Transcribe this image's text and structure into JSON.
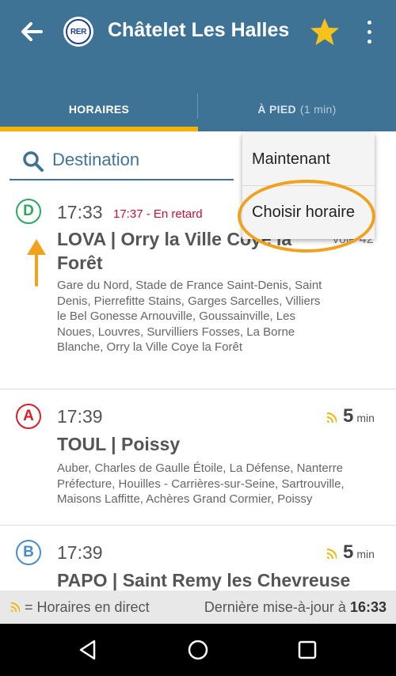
{
  "header": {
    "title": "Châtelet Les Halles",
    "network_badge": "RER",
    "back_icon": "arrow-left-icon",
    "favorite_icon": "star-icon",
    "more_icon": "more-vert-icon"
  },
  "tabs": [
    {
      "label": "HORAIRES",
      "active": true
    },
    {
      "label": "À PIED",
      "extra": "(1 min)",
      "active": false
    }
  ],
  "search": {
    "placeholder": "Destination"
  },
  "menu": {
    "items": [
      "Maintenant",
      "Choisir horaire"
    ]
  },
  "departures": [
    {
      "line": "D",
      "line_color": "#2ba760",
      "time": "17:33",
      "delay_text": "17:37 - En retard",
      "platform": "voie 42",
      "destination": "LOVA | Orry la Ville Coye la Forêt",
      "stops": "Gare du Nord, Stade de France Saint-Denis, Saint Denis, Pierrefitte Stains, Garges Sarcelles, Villiers le Bel Gonesse Arnouville, Goussainville, Les Noues, Louvres, Survilliers Fosses, La Borne Blanche, Orry la Ville Coye la Forêt"
    },
    {
      "line": "A",
      "line_color": "#d81e2b",
      "time": "17:39",
      "minutes": "5",
      "unit": "min",
      "destination": "TOUL | Poissy",
      "stops": "Auber, Charles de Gaulle Étoile, La Défense, Nanterre Préfecture, Houilles - Carrières-sur-Seine, Sartrouville, Maisons Laffitte, Achères Grand Cormier, Poissy"
    },
    {
      "line": "B",
      "line_color": "#4a8cc9",
      "time": "17:39",
      "minutes": "5",
      "unit": "min",
      "destination": "PAPO | Saint Remy les Chevreuse"
    }
  ],
  "legend": {
    "live_label": "= Horaires en direct",
    "updated_label": "Dernière mise-à-jour à",
    "updated_time": "16:33"
  },
  "colors": {
    "appbar": "#3f7396",
    "tab_indicator": "#f2b400",
    "delay": "#c8102e",
    "annotation": "#f0a21c",
    "star": "#f7c21a"
  }
}
